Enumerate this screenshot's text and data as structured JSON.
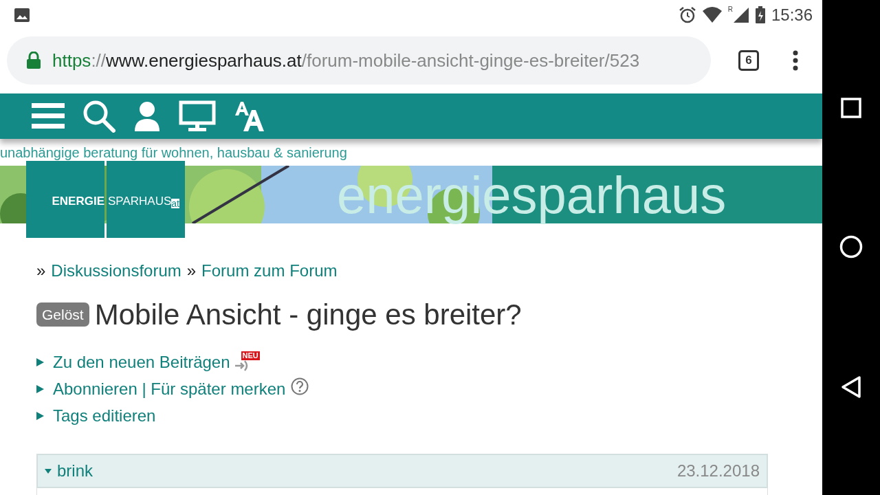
{
  "status_bar": {
    "roaming": "R",
    "time": "15:36"
  },
  "browser": {
    "url_scheme": "https",
    "url_sep": "://",
    "url_host": "www.energiesparhaus.at",
    "url_path": "/forum-mobile-ansicht-ginge-es-breiter/523",
    "tab_count": "6"
  },
  "site": {
    "tagline": "unabhängige beratung für wohnen, hausbau & sanierung",
    "logo_left": "ENERGIE",
    "logo_right": "SPARHAUS",
    "logo_suffix": "at",
    "banner_text": "energiesparhaus"
  },
  "breadcrumb": [
    {
      "sep": "»",
      "label": "Diskussionsforum"
    },
    {
      "sep": "»",
      "label": "Forum zum Forum"
    }
  ],
  "thread": {
    "badge": "Gelöst",
    "title": "Mobile Ansicht - ginge es breiter?"
  },
  "links": [
    {
      "kind": "new",
      "label": "Zu den neuen Beiträgen",
      "badge": "NEU"
    },
    {
      "kind": "help",
      "label": "Abonnieren | Für später merken"
    },
    {
      "kind": "plain",
      "label": "Tags editieren"
    }
  ],
  "post": {
    "author": "brink",
    "date": "23.12.2018",
    "expanded": true
  }
}
